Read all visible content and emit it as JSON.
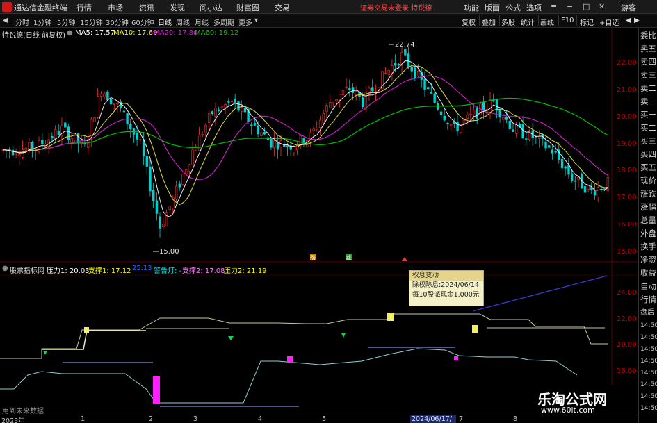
{
  "window": {
    "app_title": "通达信金融终端",
    "notice": "证券交易未登录 特锐德",
    "menu": [
      "行情",
      "市场",
      "资讯",
      "发现",
      "问小达",
      "财富圈",
      "交易"
    ],
    "right_menu": [
      "功能",
      "版面",
      "公式",
      "选项"
    ],
    "guest": "游客"
  },
  "toolbar": {
    "periods": [
      "分时",
      "1分钟",
      "5分钟",
      "15分钟",
      "30分钟",
      "60分钟",
      "日线",
      "周线",
      "月线",
      "多周期",
      "更多"
    ],
    "active_period": "日线",
    "right_buttons": [
      "复权",
      "叠加",
      "多股",
      "统计",
      "画线",
      "F10",
      "标记",
      "+自选"
    ]
  },
  "main_info": {
    "stock": "特锐德(日线 前复权)",
    "ma5": "MA5: 17.57",
    "ma10": "MA10: 17.69",
    "ma20": "MA20: 17.80",
    "ma60": "MA60: 19.12"
  },
  "main_chart": {
    "high_label": "22.74",
    "low_label": "15.00",
    "y_ticks": [
      "22.00",
      "21.00",
      "20.00",
      "19.00",
      "18.00",
      "17.00",
      "16.00",
      "15.00"
    ]
  },
  "sub_info": {
    "name": "股票指标网",
    "pressure1": "压力1: 20.03",
    "support1": "支撑1: 17.12",
    "num": "25.13",
    "warn": "警告灯: -",
    "support2": "支撑2: 17.08",
    "pressure2": "压力2: 21.19"
  },
  "sub_chart": {
    "y_ticks": [
      "24.00",
      "22.00",
      "20.00",
      "18.00"
    ],
    "markers": [
      "涨",
      "减"
    ]
  },
  "tooltip": {
    "title": "权息变动",
    "line1": "除权除息:2024/06/14",
    "line2": "每10股派现金1.000元"
  },
  "right_tabs": [
    "委比",
    "卖五",
    "卖四",
    "卖三",
    "卖二",
    "卖一",
    "买一",
    "买二",
    "买三",
    "买四",
    "买五",
    "现价",
    "涨跌",
    "涨幅",
    "总量",
    "外盘",
    "换手",
    "净资",
    "收益",
    "自动",
    "行情",
    "盘后",
    "14:50",
    "14:50",
    "14:50",
    "14:50",
    "14:50",
    "14:50",
    "14:50",
    "14:50"
  ],
  "date_axis": {
    "labels": [
      "2023年",
      "1",
      "2",
      "3",
      "4",
      "5",
      "7",
      "8"
    ],
    "highlight": "2024/06/17/一"
  },
  "future_note": "用到未来数据",
  "watermark": {
    "line1": "乐淘公式网",
    "line2": "www.60lt.com"
  },
  "colors": {
    "up": "#ff3030",
    "down": "#00d0d0",
    "ma5": "#ffffff",
    "ma10": "#ffff00",
    "ma20": "#ff00ff",
    "ma60": "#00c000"
  }
}
